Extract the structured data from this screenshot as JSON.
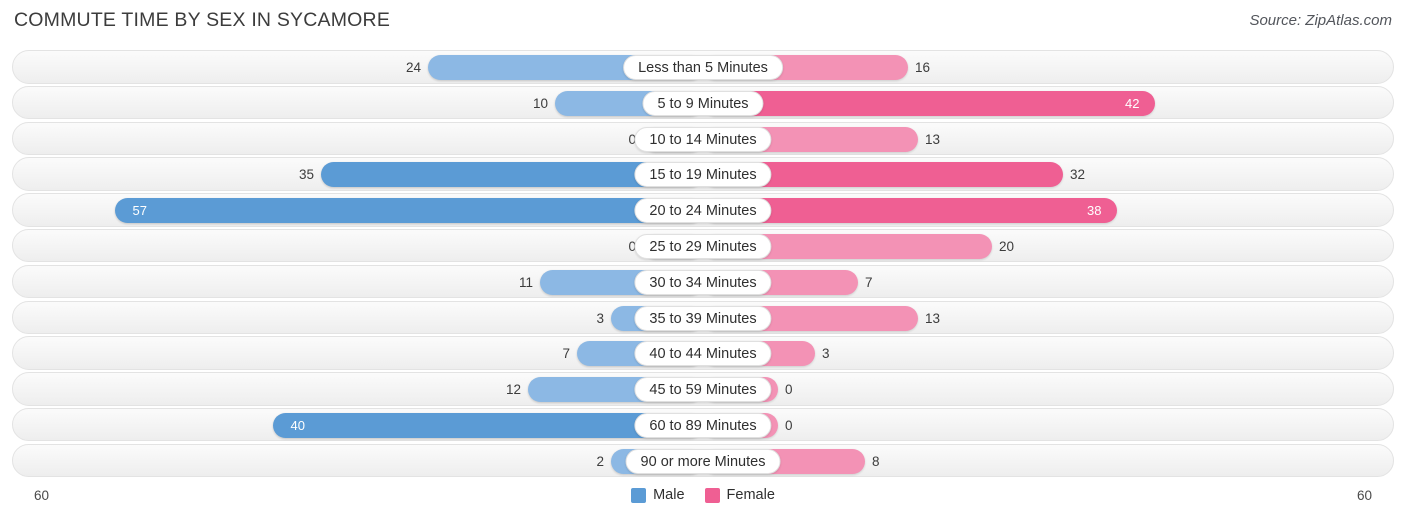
{
  "header": {
    "title": "COMMUTE TIME BY SEX IN SYCAMORE",
    "source": "Source: ZipAtlas.com"
  },
  "axis": {
    "left_max": "60",
    "right_max": "60"
  },
  "legend": {
    "items": [
      {
        "label": "Male",
        "color": "#5b9bd5"
      },
      {
        "label": "Female",
        "color": "#ef5f93"
      }
    ]
  },
  "chart_data": {
    "type": "bar",
    "title": "COMMUTE TIME BY SEX IN SYCAMORE",
    "subtitle": "Source: ZipAtlas.com",
    "orientation": "horizontal-diverging",
    "xlabel": "",
    "ylabel": "",
    "xlim": [
      60,
      60
    ],
    "grid": false,
    "legend_position": "bottom-center",
    "categories": [
      "Less than 5 Minutes",
      "5 to 9 Minutes",
      "10 to 14 Minutes",
      "15 to 19 Minutes",
      "20 to 24 Minutes",
      "25 to 29 Minutes",
      "30 to 34 Minutes",
      "35 to 39 Minutes",
      "40 to 44 Minutes",
      "45 to 59 Minutes",
      "60 to 89 Minutes",
      "90 or more Minutes"
    ],
    "series": [
      {
        "name": "Male",
        "color": "#5b9bd5",
        "values": [
          24,
          10,
          0,
          35,
          57,
          0,
          11,
          3,
          7,
          12,
          40,
          2
        ]
      },
      {
        "name": "Female",
        "color": "#ef5f93",
        "values": [
          16,
          42,
          13,
          32,
          38,
          20,
          7,
          13,
          3,
          0,
          0,
          8
        ]
      }
    ]
  },
  "rows": [
    {
      "label": "Less than 5 Minutes",
      "male": "24",
      "female": "16",
      "male_w": 275,
      "female_w": 205,
      "male_strong": false,
      "female_strong": false,
      "male_in": false,
      "female_in": false
    },
    {
      "label": "5 to 9 Minutes",
      "male": "10",
      "female": "42",
      "male_w": 148,
      "female_w": 452,
      "male_strong": false,
      "female_strong": true,
      "male_in": false,
      "female_in": true
    },
    {
      "label": "10 to 14 Minutes",
      "male": "0",
      "female": "13",
      "male_w": 60,
      "female_w": 215,
      "male_strong": false,
      "female_strong": false,
      "male_in": false,
      "female_in": false
    },
    {
      "label": "15 to 19 Minutes",
      "male": "35",
      "female": "32",
      "male_w": 382,
      "female_w": 360,
      "male_strong": true,
      "female_strong": true,
      "male_in": false,
      "female_in": false
    },
    {
      "label": "20 to 24 Minutes",
      "male": "57",
      "female": "38",
      "male_w": 588,
      "female_w": 414,
      "male_strong": true,
      "female_strong": true,
      "male_in": true,
      "female_in": true
    },
    {
      "label": "25 to 29 Minutes",
      "male": "0",
      "female": "20",
      "male_w": 60,
      "female_w": 289,
      "male_strong": false,
      "female_strong": false,
      "male_in": false,
      "female_in": false
    },
    {
      "label": "30 to 34 Minutes",
      "male": "11",
      "female": "7",
      "male_w": 163,
      "female_w": 155,
      "male_strong": false,
      "female_strong": false,
      "male_in": false,
      "female_in": false
    },
    {
      "label": "35 to 39 Minutes",
      "male": "3",
      "female": "13",
      "male_w": 92,
      "female_w": 215,
      "male_strong": false,
      "female_strong": false,
      "male_in": false,
      "female_in": false
    },
    {
      "label": "40 to 44 Minutes",
      "male": "7",
      "female": "3",
      "male_w": 126,
      "female_w": 112,
      "male_strong": false,
      "female_strong": false,
      "male_in": false,
      "female_in": false
    },
    {
      "label": "45 to 59 Minutes",
      "male": "12",
      "female": "0",
      "male_w": 175,
      "female_w": 75,
      "male_strong": false,
      "female_strong": false,
      "male_in": false,
      "female_in": false
    },
    {
      "label": "60 to 89 Minutes",
      "male": "40",
      "female": "0",
      "male_w": 430,
      "female_w": 75,
      "male_strong": true,
      "female_strong": false,
      "male_in": true,
      "female_in": false
    },
    {
      "label": "90 or more Minutes",
      "male": "2",
      "female": "8",
      "male_w": 92,
      "female_w": 162,
      "male_strong": false,
      "female_strong": false,
      "male_in": false,
      "female_in": false
    }
  ]
}
